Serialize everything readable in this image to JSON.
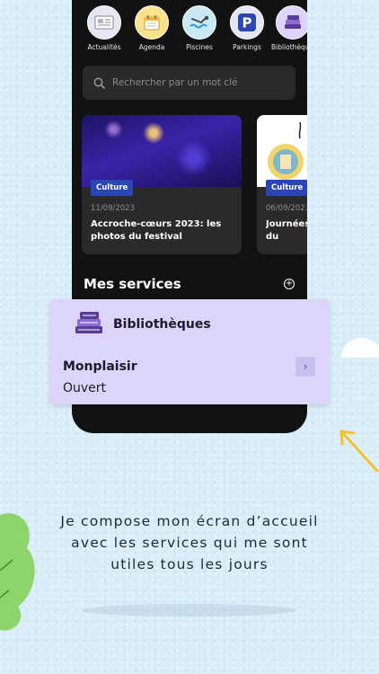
{
  "shortcuts": [
    {
      "label": "Actualités",
      "icon": "newspaper-icon",
      "bg": "#e5e5f5"
    },
    {
      "label": "Agenda",
      "icon": "calendar-icon",
      "bg": "#fbe18a"
    },
    {
      "label": "Piscines",
      "icon": "swimming-icon",
      "bg": "#c6e9f4"
    },
    {
      "label": "Parkings",
      "icon": "parking-icon",
      "bg": "#e5e5f5"
    },
    {
      "label": "Bibliothèques",
      "icon": "books-icon",
      "bg": "#dcd4fb"
    }
  ],
  "search": {
    "placeholder": "Rechercher par un mot clé"
  },
  "news": [
    {
      "tag": "Culture",
      "date": "11/09/2023",
      "title": "Accroche-cœurs 2023: les photos du festival"
    },
    {
      "tag": "Culture",
      "date": "06/09/2023",
      "title": "Journées du patrimoine"
    }
  ],
  "services": {
    "title": "Mes services"
  },
  "service_card": {
    "name": "Bibliothèques",
    "place": "Monplaisir",
    "status": "Ouvert"
  },
  "caption": {
    "line1": "Je compose mon écran d’accueil",
    "line2": "avec les services qui me sont",
    "line3": "utiles tous les jours"
  },
  "colors": {
    "accent": "#2b46b3",
    "card": "#dcd4fb",
    "background": "#d9edf8"
  }
}
